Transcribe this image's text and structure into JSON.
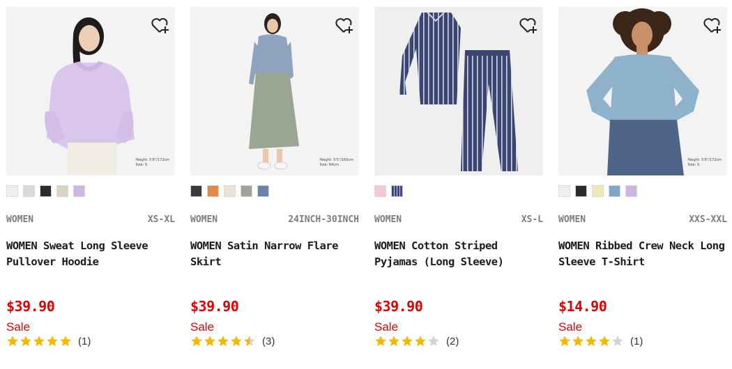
{
  "products": [
    {
      "category": "WOMEN",
      "size_range": "XS-XL",
      "name": "WOMEN Sweat Long Sleeve Pullover Hoodie",
      "price": "$39.90",
      "sale_label": "Sale",
      "rating": 5,
      "review_count": "(1)",
      "model_note_line1": "Height: 5'8\"/172cm",
      "model_note_line2": "Size: S",
      "swatch_colors": [
        "#efefef",
        "#d9d9d9",
        "#2b2b2b",
        "#d9d4bd",
        "#cdb6e3"
      ]
    },
    {
      "category": "WOMEN",
      "size_range": "24INCH-30INCH",
      "name": "WOMEN Satin Narrow Flare Skirt",
      "price": "$39.90",
      "sale_label": "Sale",
      "rating": 4.5,
      "review_count": "(3)",
      "model_note_line1": "Height: 5'5\"/165cm",
      "model_note_line2": "Size: 64cm",
      "swatch_colors": [
        "#3a3a3d",
        "#e08a4a",
        "#ece4d2",
        "#9ea39a",
        "#6784a8"
      ]
    },
    {
      "category": "WOMEN",
      "size_range": "XS-L",
      "name": "WOMEN Cotton Striped Pyjamas (Long Sleeve)",
      "price": "$39.90",
      "sale_label": "Sale",
      "rating": 4,
      "review_count": "(2)",
      "model_note_line1": "",
      "model_note_line2": "",
      "swatch_colors": [
        "#f1c9d6",
        "#3a4670"
      ]
    },
    {
      "category": "WOMEN",
      "size_range": "XXS-XXL",
      "name": "WOMEN Ribbed Crew Neck Long Sleeve T-Shirt",
      "price": "$14.90",
      "sale_label": "Sale",
      "rating": 4,
      "review_count": "(1)",
      "model_note_line1": "Height: 5'8\"/172cm",
      "model_note_line2": "Size: S",
      "swatch_colors": [
        "#efefef",
        "#2b2b2b",
        "#ecebb8",
        "#7fa6c9",
        "#cfb3e0"
      ]
    }
  ],
  "colors": {
    "price_red": "#e00000",
    "star_gold": "#f5b800",
    "star_empty": "#d3d3d3"
  }
}
